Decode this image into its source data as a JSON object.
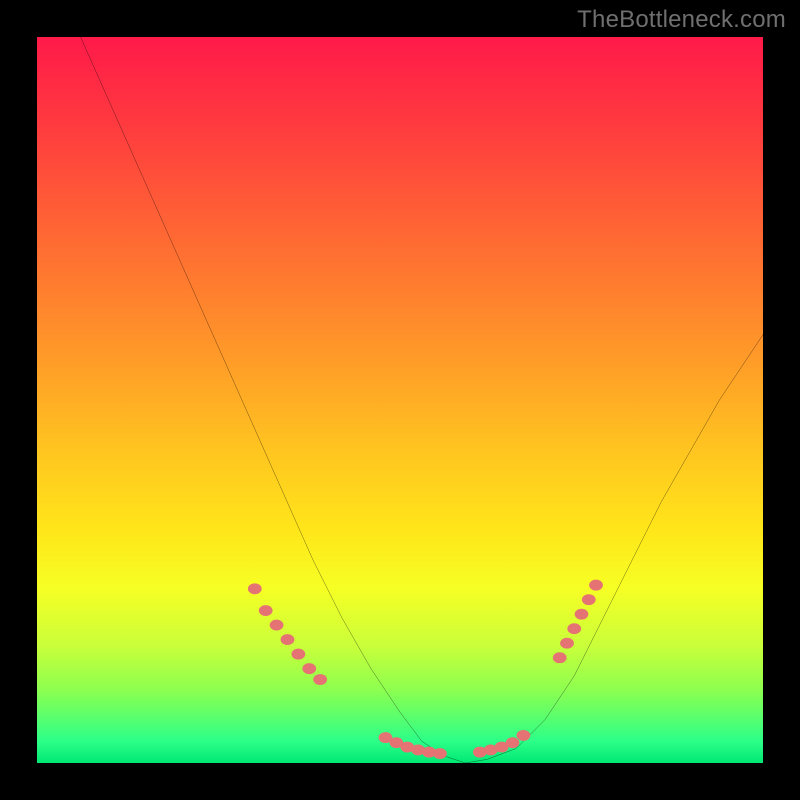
{
  "watermark": "TheBottleneck.com",
  "chart_data": {
    "type": "line",
    "title": "",
    "xlabel": "",
    "ylabel": "",
    "xlim": [
      0,
      100
    ],
    "ylim": [
      0,
      100
    ],
    "curve": {
      "name": "bottleneck-curve",
      "x": [
        6,
        10,
        14,
        18,
        22,
        26,
        30,
        34,
        38,
        42,
        46,
        50,
        53,
        56,
        59,
        62,
        66,
        70,
        74,
        78,
        82,
        86,
        90,
        94,
        98,
        100
      ],
      "y": [
        100,
        91,
        82,
        73,
        64,
        55,
        46,
        37,
        28,
        20,
        13,
        7,
        3,
        1,
        0,
        0.5,
        2,
        6,
        12,
        20,
        28,
        36,
        43,
        50,
        56,
        59
      ]
    },
    "marker_segments": [
      {
        "name": "left-descent-markers",
        "x": [
          30.0,
          31.5,
          33.0,
          34.5,
          36.0,
          37.5,
          39.0
        ],
        "y": [
          24.0,
          21.0,
          19.0,
          17.0,
          15.0,
          13.0,
          11.5
        ]
      },
      {
        "name": "bottom-left-markers",
        "x": [
          48.0,
          49.5,
          51.0,
          52.5,
          54.0,
          55.5
        ],
        "y": [
          3.5,
          2.8,
          2.2,
          1.8,
          1.5,
          1.3
        ]
      },
      {
        "name": "bottom-right-markers",
        "x": [
          61.0,
          62.5,
          64.0,
          65.5,
          67.0
        ],
        "y": [
          1.5,
          1.8,
          2.2,
          2.8,
          3.8
        ]
      },
      {
        "name": "right-ascent-markers",
        "x": [
          72.0,
          73.0,
          74.0,
          75.0,
          76.0,
          77.0
        ],
        "y": [
          14.5,
          16.5,
          18.5,
          20.5,
          22.5,
          24.5
        ]
      }
    ],
    "gradient_colors": {
      "top": "#ff1a49",
      "mid_upper": "#ff9a28",
      "mid": "#ffe61a",
      "mid_lower": "#c8ff3a",
      "bottom": "#00e874"
    },
    "curve_color": "#000000",
    "marker_color": "#e57373"
  }
}
